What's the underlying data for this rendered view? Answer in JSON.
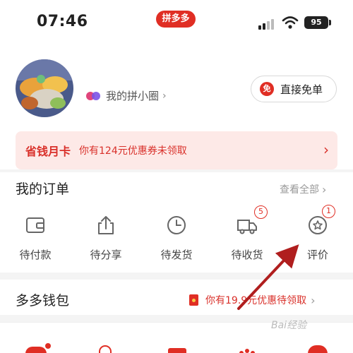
{
  "status_bar": {
    "time": "07:46",
    "app_name": "拼多多",
    "battery": "95"
  },
  "profile": {
    "circle_label": "我的拼小圈",
    "circle_chevron": "›",
    "free_button_icon_text": "免",
    "free_button_label": "直接免单"
  },
  "savings_card": {
    "title": "省钱月卡",
    "description": "你有124元优惠券未领取",
    "chevron": "›"
  },
  "orders": {
    "title": "我的订单",
    "view_all": "查看全部",
    "view_all_chevron": "›",
    "items": [
      {
        "label": "待付款",
        "icon": "wallet-icon",
        "badge": ""
      },
      {
        "label": "待分享",
        "icon": "share-icon",
        "badge": ""
      },
      {
        "label": "待发货",
        "icon": "clock-icon",
        "badge": ""
      },
      {
        "label": "待收货",
        "icon": "truck-icon",
        "badge": "5"
      },
      {
        "label": "评价",
        "icon": "review-icon",
        "badge": "1"
      }
    ]
  },
  "wallet": {
    "title": "多多钱包",
    "promo": "你有19.9元优惠待领取",
    "chevron": "›"
  },
  "watermark": "Bai经验",
  "colors": {
    "brand_red": "#e02e24",
    "banner_bg": "#fde9e7",
    "annotation_arrow": "#b01e1e"
  }
}
